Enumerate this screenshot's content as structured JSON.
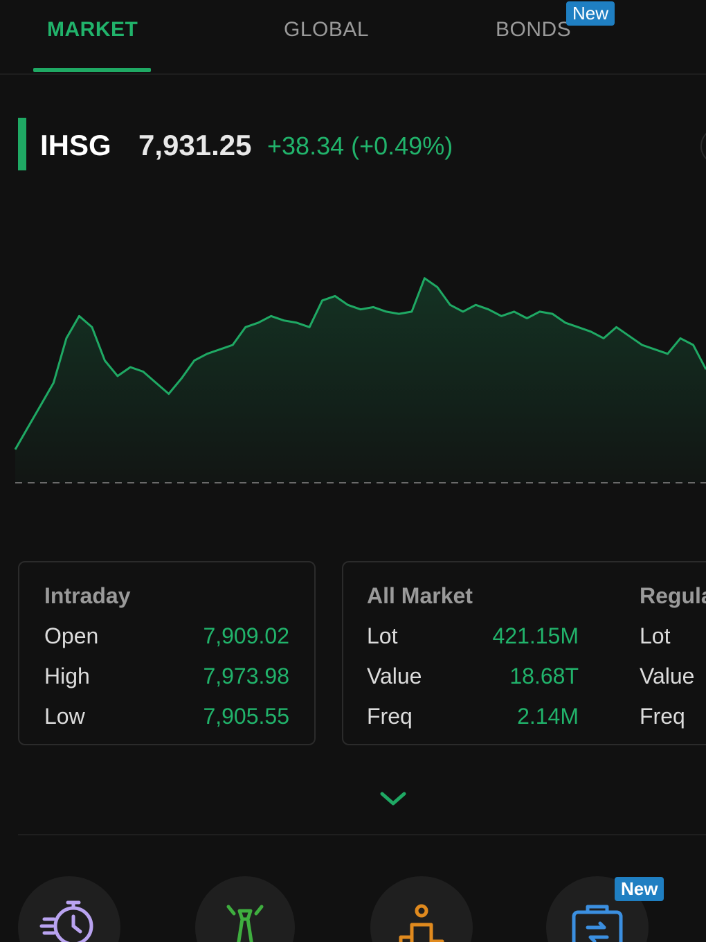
{
  "tabs": [
    {
      "label": "MARKET",
      "active": true
    },
    {
      "label": "GLOBAL",
      "active": false
    },
    {
      "label": "BONDS",
      "active": false,
      "badge": "New"
    }
  ],
  "index": {
    "name": "IHSG",
    "price": "7,931.25",
    "change": "+38.34 (+0.49%)"
  },
  "chart_data": {
    "type": "area",
    "series_color": "#1fa964",
    "baseline_style": "dashed",
    "ylim": [
      7880,
      7985
    ],
    "values": [
      7895,
      7905,
      7915,
      7925,
      7945,
      7955,
      7950,
      7935,
      7928,
      7932,
      7930,
      7925,
      7920,
      7927,
      7935,
      7938,
      7940,
      7942,
      7950,
      7952,
      7955,
      7953,
      7952,
      7950,
      7962,
      7964,
      7960,
      7958,
      7959,
      7957,
      7956,
      7957,
      7972,
      7968,
      7960,
      7957,
      7960,
      7958,
      7955,
      7957,
      7954,
      7957,
      7956,
      7952,
      7950,
      7948,
      7945,
      7950,
      7946,
      7942,
      7940,
      7938,
      7945,
      7942,
      7931
    ]
  },
  "cards": [
    {
      "title": "Intraday",
      "rows": [
        {
          "label": "Open",
          "value": "7,909.02"
        },
        {
          "label": "High",
          "value": "7,973.98"
        },
        {
          "label": "Low",
          "value": "7,905.55"
        }
      ]
    },
    {
      "title": "All Market",
      "rows": [
        {
          "label": "Lot",
          "value": "421.15M"
        },
        {
          "label": "Value",
          "value": "18.68T"
        },
        {
          "label": "Freq",
          "value": "2.14M"
        }
      ]
    },
    {
      "title": "Regula",
      "rows": [
        {
          "label": "Lot",
          "value": ""
        },
        {
          "label": "Value",
          "value": ""
        },
        {
          "label": "Freq",
          "value": ""
        }
      ]
    }
  ],
  "bottom_icons": [
    {
      "icon": "timer-icon",
      "color": "#b9a3f0"
    },
    {
      "icon": "tie-icon",
      "color": "#3fae3f"
    },
    {
      "icon": "podium-icon",
      "color": "#e08a1e"
    },
    {
      "icon": "briefcase-transfer-icon",
      "color": "#3b8fe0",
      "badge": "New"
    }
  ]
}
